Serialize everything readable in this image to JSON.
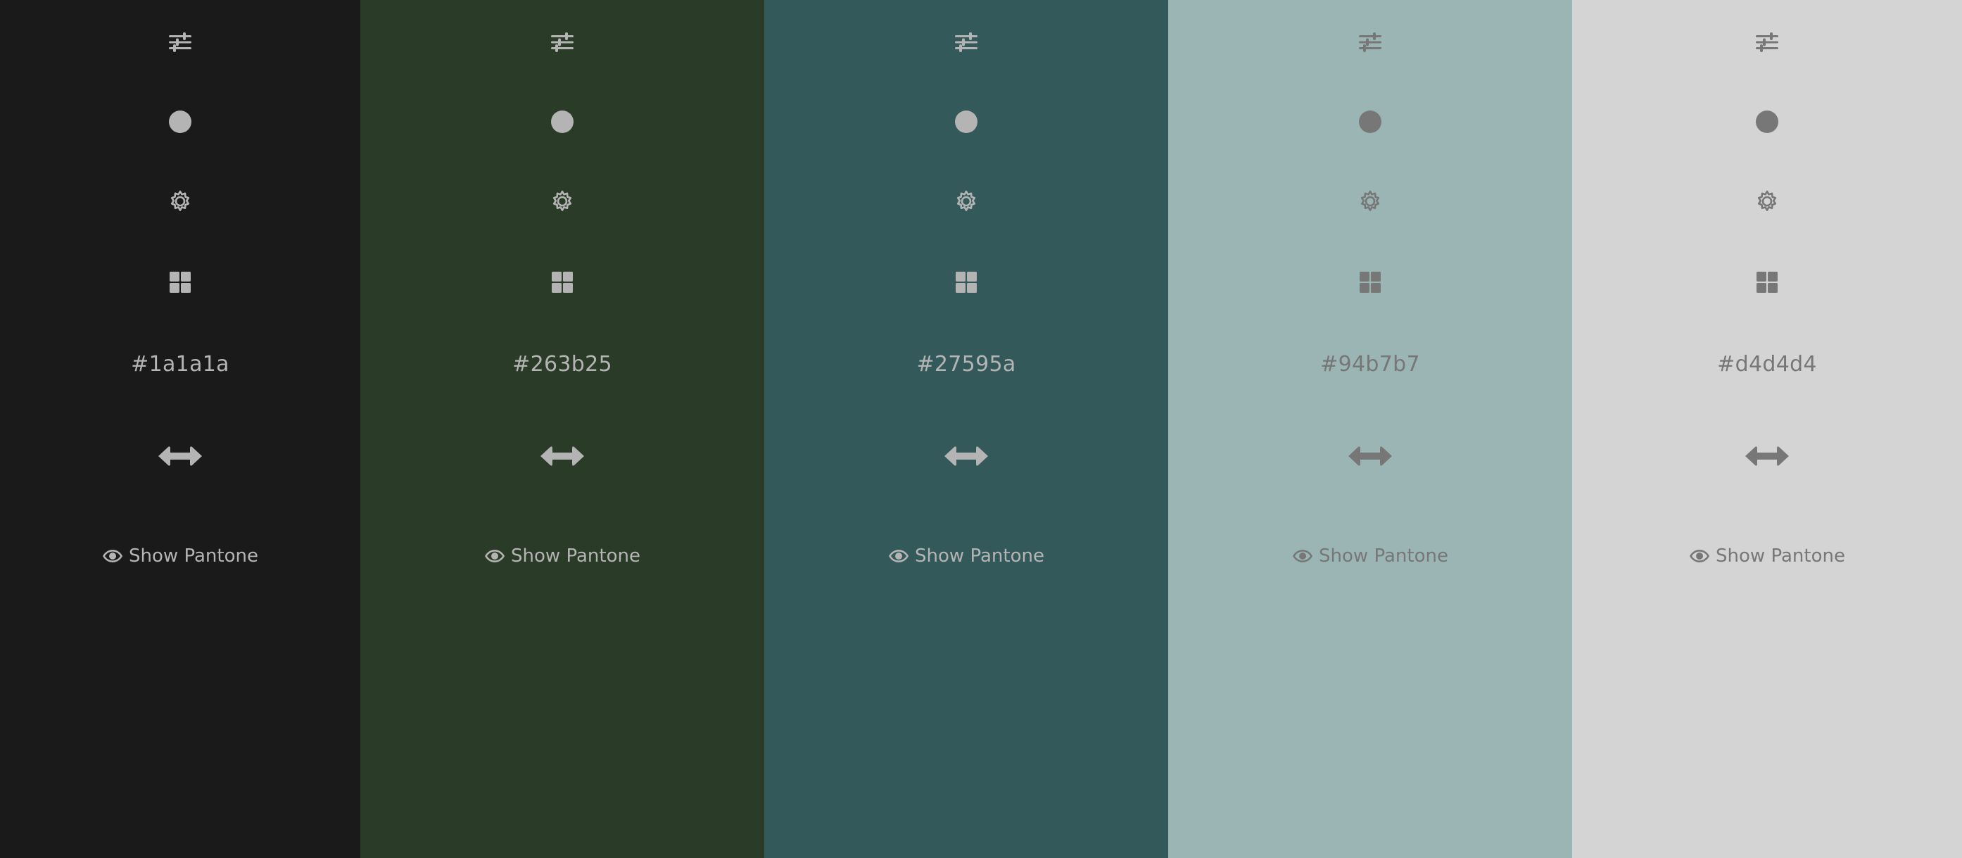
{
  "palette": {
    "colors": [
      {
        "hex": "#1a1a1a",
        "bg": "#1a1a1a",
        "theme": "dark-bg"
      },
      {
        "hex": "#263b25",
        "bg": "#2a3b27",
        "theme": "dark-bg"
      },
      {
        "hex": "#27595a",
        "bg": "#34595b",
        "theme": "dark-bg"
      },
      {
        "hex": "#94b7b7",
        "bg": "#9bb5b5",
        "theme": "light-bg"
      },
      {
        "hex": "#d4d4d4",
        "bg": "#d4d4d4",
        "theme": "light-bg"
      }
    ],
    "show_pantone_label": "Show Pantone",
    "icons": {
      "adjust": "sliders-icon",
      "lock": "circle-lock-icon",
      "settings": "gear-icon",
      "shades": "grid-shades-icon",
      "drag": "drag-arrows-icon",
      "pantone": "eye-icon"
    }
  }
}
